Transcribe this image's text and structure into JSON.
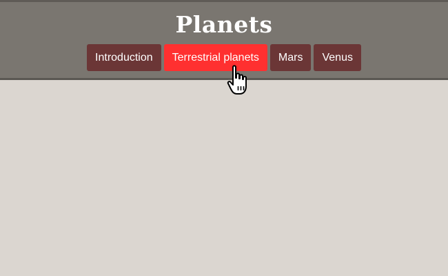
{
  "header": {
    "title": "Planets"
  },
  "nav": {
    "items": [
      {
        "label": "Introduction",
        "active": false
      },
      {
        "label": "Terrestrial planets",
        "active": true
      },
      {
        "label": "Mars",
        "active": false
      },
      {
        "label": "Venus",
        "active": false
      }
    ]
  },
  "colors": {
    "header_bg": "#7a7670",
    "page_bg": "#dbd6d0",
    "button_bg": "#6b3636",
    "button_active_bg": "#ff3030"
  },
  "cursor": {
    "icon": "hand-pointer-icon"
  }
}
